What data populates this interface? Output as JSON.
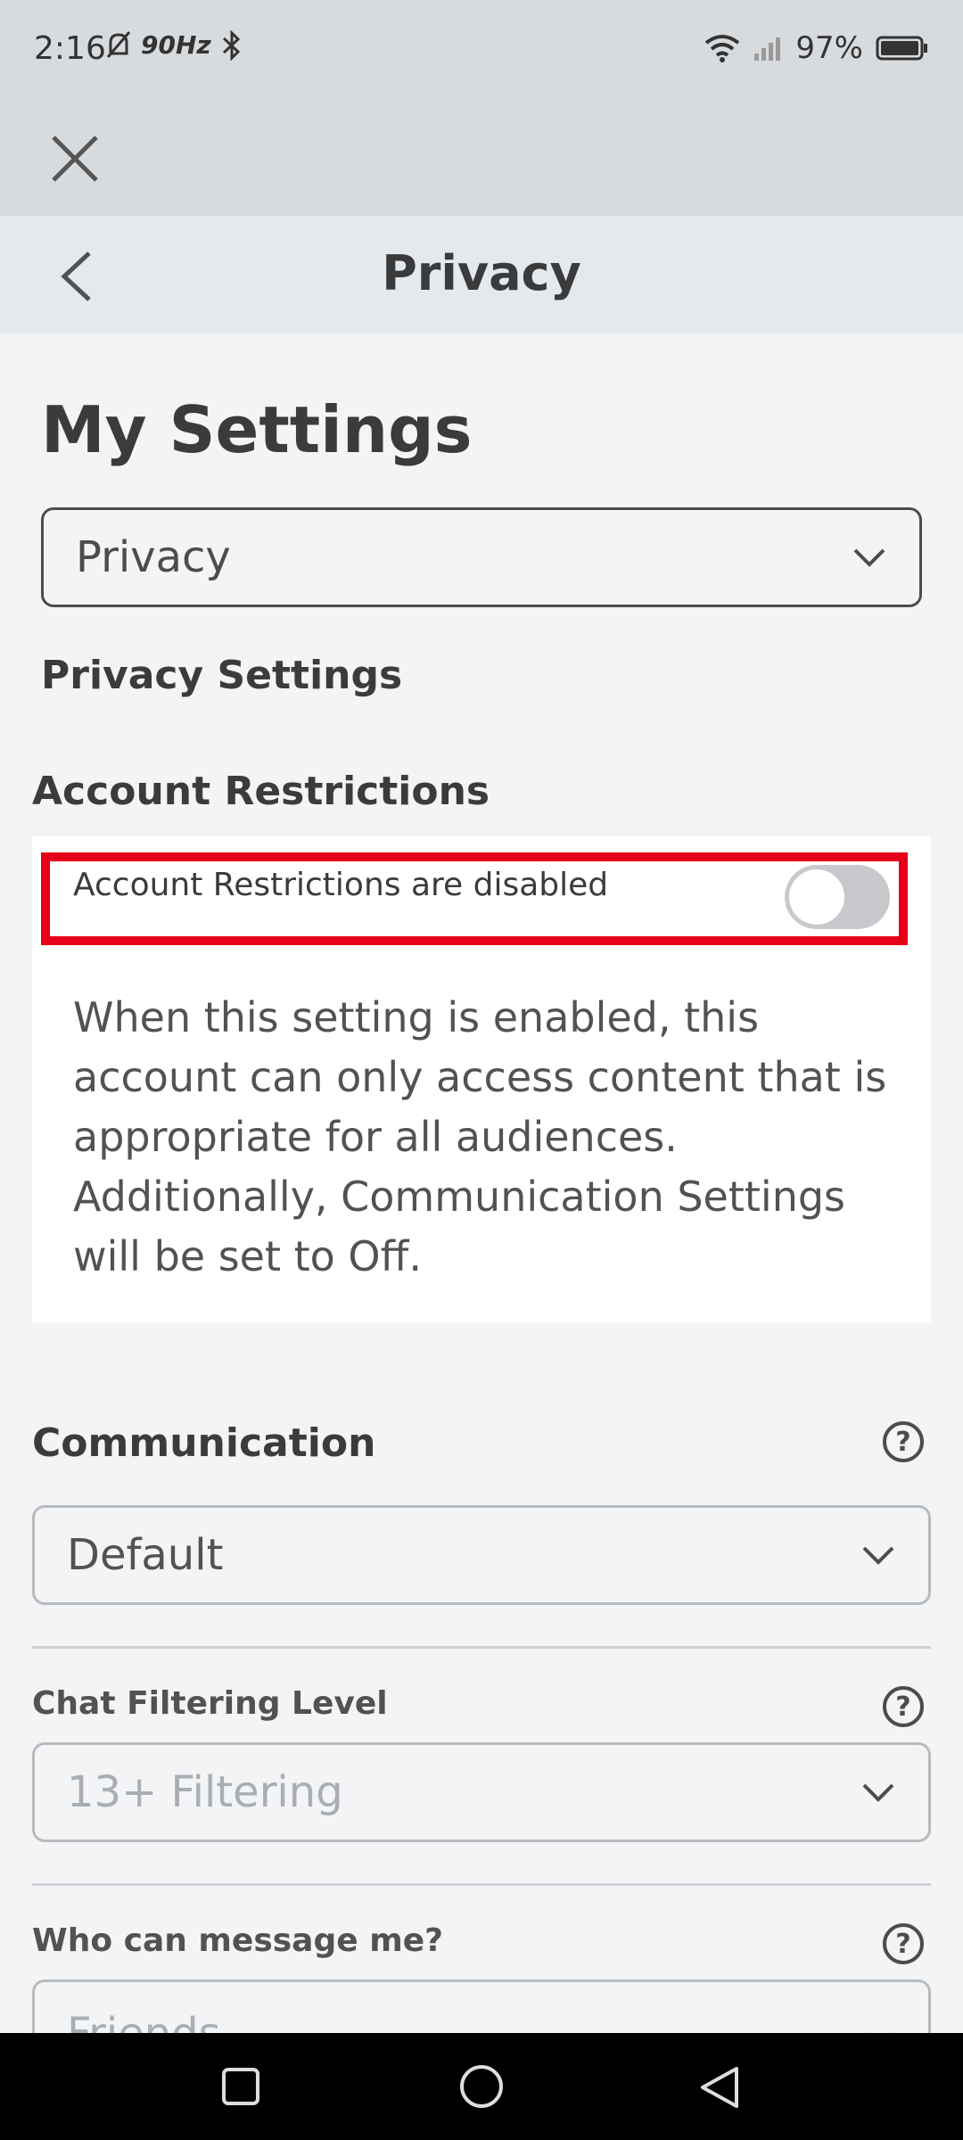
{
  "status_bar": {
    "time": "2:16",
    "refresh_rate": "90Hz",
    "battery": "97%"
  },
  "header": {
    "title": "Privacy"
  },
  "page": {
    "title": "My Settings",
    "category_select": "Privacy",
    "section_heading": "Privacy Settings"
  },
  "account_restrictions": {
    "title": "Account Restrictions",
    "toggle_label": "Account Restrictions are disabled",
    "toggle_on": false,
    "description": "When this setting is enabled, this account can only access content that is appropriate for all audiences. Additionally, Communication Settings will be set to Off."
  },
  "communication": {
    "title": "Communication",
    "select_value": "Default",
    "chat_filter": {
      "label": "Chat Filtering Level",
      "value": "13+ Filtering"
    },
    "who_can_message": {
      "label": "Who can message me?",
      "value": "Friends"
    }
  },
  "icons": [
    "close-icon",
    "back-chevron-icon",
    "chevron-down-icon",
    "help-icon",
    "toggle-switch",
    "nav-recents-icon",
    "nav-home-icon",
    "nav-back-icon"
  ],
  "colors": {
    "highlight": "#e8001b",
    "toggle_off": "#c7c9cc"
  }
}
